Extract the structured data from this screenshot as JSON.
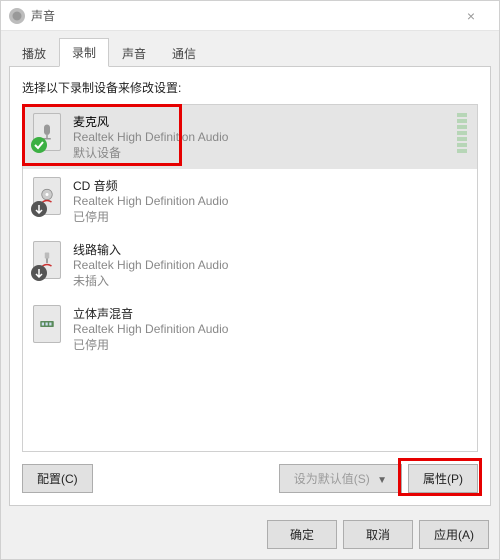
{
  "window": {
    "title": "声音"
  },
  "tabs": [
    {
      "label": "播放"
    },
    {
      "label": "录制"
    },
    {
      "label": "声音"
    },
    {
      "label": "通信"
    }
  ],
  "active_tab_index": 1,
  "instruction": "选择以下录制设备来修改设置:",
  "devices": [
    {
      "name": "麦克风",
      "desc": "Realtek High Definition Audio",
      "status": "默认设备",
      "selected": true,
      "badge": "ok",
      "has_meter": true
    },
    {
      "name": "CD 音频",
      "desc": "Realtek High Definition Audio",
      "status": "已停用",
      "selected": false,
      "badge": "down",
      "has_meter": false
    },
    {
      "name": "线路输入",
      "desc": "Realtek High Definition Audio",
      "status": "未插入",
      "selected": false,
      "badge": "down",
      "has_meter": false
    },
    {
      "name": "立体声混音",
      "desc": "Realtek High Definition Audio",
      "status": "已停用",
      "selected": false,
      "badge": null,
      "has_meter": false
    }
  ],
  "buttons": {
    "configure": "配置(C)",
    "set_default": "设为默认值(S)",
    "properties": "属性(P)"
  },
  "bottom": {
    "ok": "确定",
    "cancel": "取消",
    "apply": "应用(A)"
  },
  "highlights": {
    "device_0": true,
    "properties_button": true
  }
}
